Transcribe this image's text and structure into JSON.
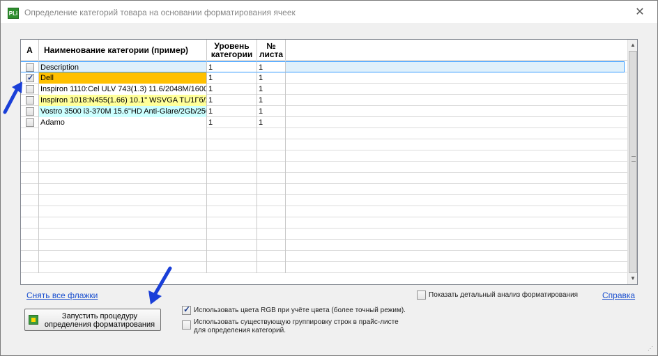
{
  "window": {
    "title": "Определение категорий товара на основании форматирования ячеек",
    "app_icon_text": "PLi",
    "close_symbol": "✕"
  },
  "grid": {
    "columns": [
      {
        "key": "a",
        "label": "A"
      },
      {
        "key": "name",
        "label": "Наименование категории (пример)"
      },
      {
        "key": "level",
        "label": "Уровень категории"
      },
      {
        "key": "sheet",
        "label": "№ листа"
      }
    ],
    "rows": [
      {
        "checked": false,
        "name": "Description",
        "level": "1",
        "sheet": "1",
        "bg": "#dff0fb",
        "selected": true
      },
      {
        "checked": true,
        "name": "Dell",
        "level": "1",
        "sheet": "1",
        "bg": "#ffc000",
        "selected": false
      },
      {
        "checked": false,
        "name": "Inspiron 1110:Cel ULV 743(1.3) 11.6/2048M/1600",
        "level": "1",
        "sheet": "1",
        "bg": "#ffffff",
        "selected": false
      },
      {
        "checked": false,
        "name": "Inspiron 1018:N455(1.66) 10.1\" WSVGA TL/1Гб/2",
        "level": "1",
        "sheet": "1",
        "bg": "#ffff99",
        "selected": false
      },
      {
        "checked": false,
        "name": "Vostro 3500 i3-370M 15.6\"HD Anti-Glare/2Gb/250",
        "level": "1",
        "sheet": "1",
        "bg": "#ccffff",
        "selected": false
      },
      {
        "checked": false,
        "name": "Adamo",
        "level": "1",
        "sheet": "1",
        "bg": "#ffffff",
        "selected": false
      }
    ],
    "empty_rows": 13
  },
  "links": {
    "uncheck_all": "Снять все флажки",
    "help": "Справка"
  },
  "options": {
    "detailed_analysis": {
      "label": "Показать детальный анализ форматирования",
      "checked": false
    },
    "use_rgb": {
      "label": "Использовать цвета RGB при учёте цвета (более точный режим).",
      "checked": true
    },
    "use_grouping": {
      "label": "Использовать существующую группировку строк в прайс-листе для определения категорий.",
      "checked": false
    }
  },
  "run_button": {
    "label": "Запустить процедуру определения форматирования"
  },
  "colors": {
    "arrow": "#1a3fd8",
    "link": "#1a4fcf"
  }
}
